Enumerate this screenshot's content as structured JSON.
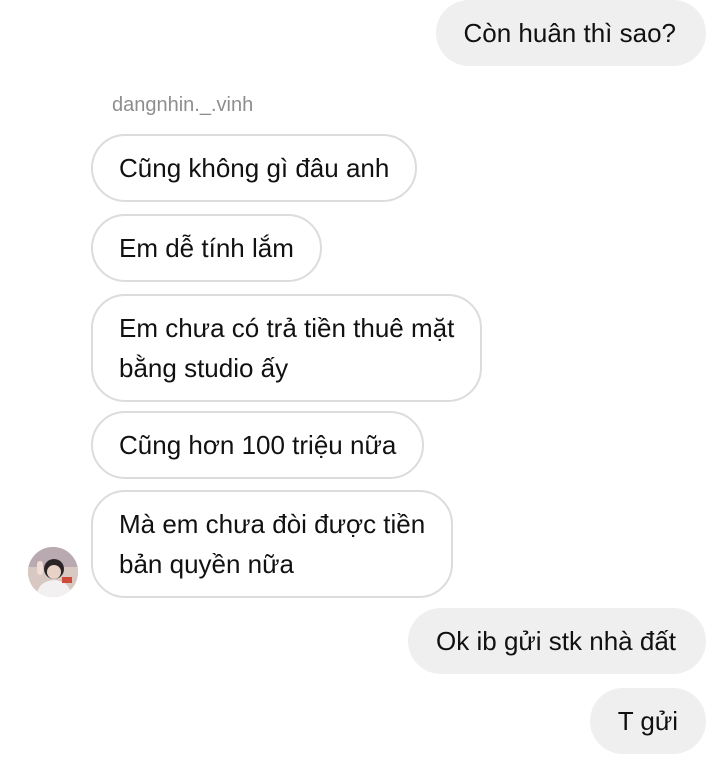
{
  "thread": {
    "sender_username": "dangnhin._.vinh",
    "messages": [
      {
        "direction": "outgoing",
        "text": "Còn huân thì sao?"
      },
      {
        "direction": "incoming",
        "text": "Cũng không gì đâu anh"
      },
      {
        "direction": "incoming",
        "text": "Em dễ tính lắm"
      },
      {
        "direction": "incoming",
        "line1": "Em chưa có trả tiền thuê mặt",
        "line2": "bằng studio ấy"
      },
      {
        "direction": "incoming",
        "text": "Cũng hơn 100 triệu nữa"
      },
      {
        "direction": "incoming",
        "line1": "Mà em chưa đòi được tiền",
        "line2": "bản quyền nữa"
      },
      {
        "direction": "outgoing",
        "text": "Ok ib gửi stk nhà đất"
      },
      {
        "direction": "outgoing",
        "text": "T gửi"
      }
    ]
  },
  "colors": {
    "outgoing_bubble": "#efefef",
    "incoming_border": "#dcdcdc",
    "username_text": "#8e8e8e"
  },
  "icons": {
    "avatar": "sender-avatar"
  }
}
